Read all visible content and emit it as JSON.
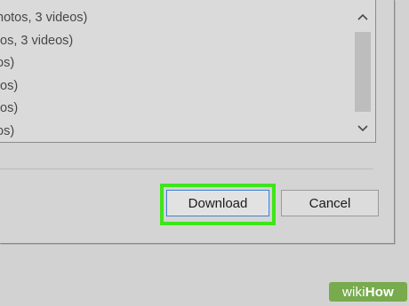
{
  "list": {
    "items": [
      "hotos, 3 videos)",
      "tos, 3 videos)",
      "os)",
      "tos)",
      "tos)",
      "os)"
    ]
  },
  "scrollbar": {
    "up_icon": "chevron-up-icon",
    "down_icon": "chevron-down-icon"
  },
  "buttons": {
    "download_label": "Download",
    "cancel_label": "Cancel"
  },
  "watermark": {
    "prefix": "wiki",
    "brand": "How"
  },
  "colors": {
    "highlight": "#3fe51a",
    "focus_border": "#3c7fc9"
  }
}
